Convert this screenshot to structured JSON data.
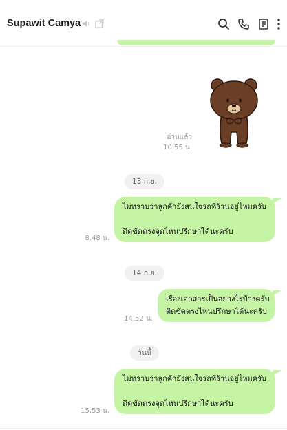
{
  "header": {
    "contact_name": "Supawit Camya",
    "icons": [
      "speaker-icon",
      "external-window-icon",
      "search-icon",
      "phone-icon",
      "notes-icon",
      "more-vertical-icon"
    ]
  },
  "messages": {
    "sticker": {
      "read_label": "อ่านแล้ว",
      "time": "10.55 น."
    },
    "date_1": "13 ก.ย.",
    "msg_1": {
      "line_1": "ไม่ทราบว่าลูกค้ายังสนใจรถที่ร้านอยู่ไหมครับ",
      "line_2": "ติดขัดตรงจุดไหนปรึกษาได้นะครับ",
      "time": "8.48 น."
    },
    "date_2": "14 ก.ย.",
    "msg_2": {
      "line_1": "เรื่องเอกสารเป็นอย่างไรบ้างครับ",
      "line_2": "ติดขัดตรงไหนปรึกษาได้นะครับ",
      "time": "14.52 น."
    },
    "date_3": "วันนี้",
    "msg_3": {
      "line_1": "ไม่ทราบว่าลูกค้ายังสนใจรถที่ร้านอยู่ไหมครับ",
      "line_2": "ติดขัดตรงจุดไหนปรึกษาได้นะครับ",
      "time": "15.53 น."
    }
  },
  "colors": {
    "bubble": "#c6f4a5",
    "date_pill": "#f1f1f1",
    "meta_text": "#9a9a9a"
  }
}
